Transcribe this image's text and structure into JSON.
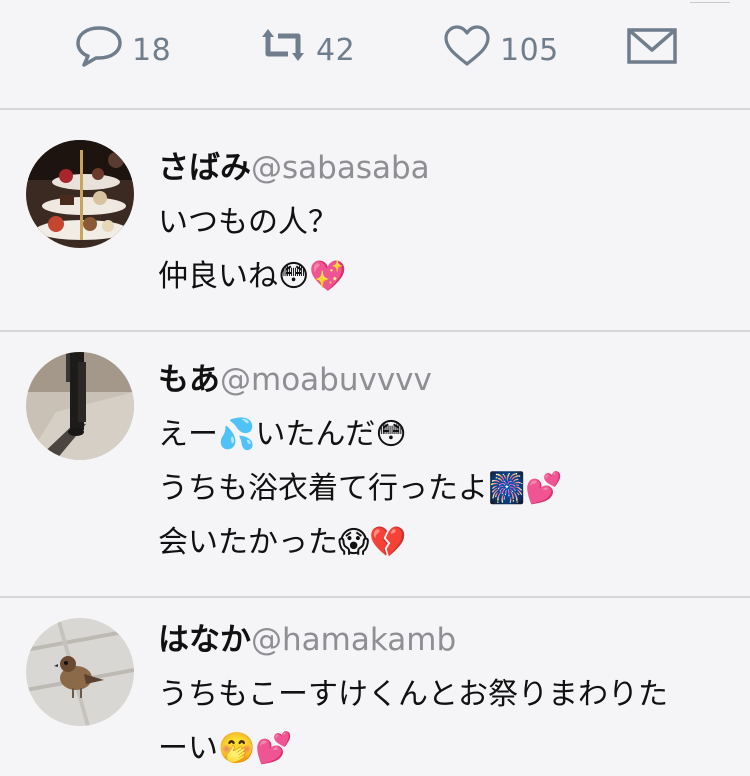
{
  "actions": {
    "replies": "18",
    "retweets": "42",
    "likes": "105",
    "icon_reply": "speech-bubble-icon",
    "icon_retweet": "retweet-icon",
    "icon_like": "heart-icon",
    "icon_dm": "envelope-icon",
    "icon_color": "#6f7d8c"
  },
  "replies": [
    {
      "name": "さばみ",
      "handle": "@sabasaba",
      "lines": [
        "いつもの人？",
        "仲良いね😳💖"
      ]
    },
    {
      "name": "もあ",
      "handle": "@moabuvvvv",
      "lines": [
        "えー💦いたんだ😳",
        "うちも浴衣着て行ったよ🎆💕",
        "会いたかった😱💔"
      ]
    },
    {
      "name": "はなか",
      "handle": "@hamakamb",
      "lines": [
        "うちもこーすけくんとお祭りまわりた",
        "ーい🤭💕"
      ]
    }
  ]
}
